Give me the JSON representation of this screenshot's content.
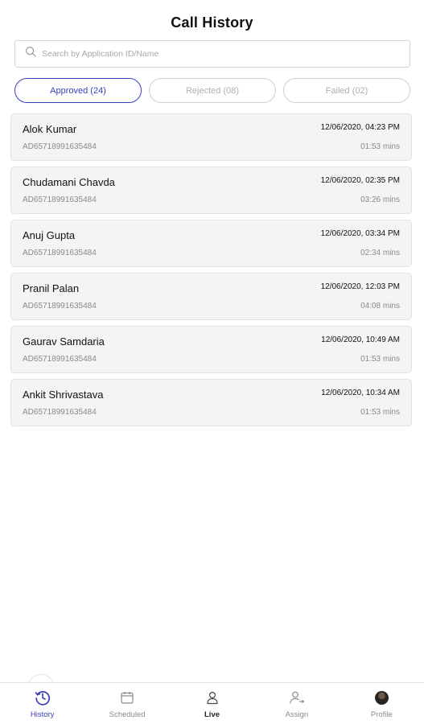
{
  "header": {
    "title": "Call History"
  },
  "search": {
    "placeholder": "Search by Application ID/Name"
  },
  "tabs": [
    {
      "label": "Approved (24)",
      "active": true
    },
    {
      "label": "Rejected (08)",
      "active": false
    },
    {
      "label": "Failed (02)",
      "active": false
    }
  ],
  "calls": [
    {
      "name": "Alok Kumar",
      "app_id": "AD65718991635484",
      "datetime": "12/06/2020, 04:23 PM",
      "duration": "01:53 mins"
    },
    {
      "name": "Chudamani Chavda",
      "app_id": "AD65718991635484",
      "datetime": "12/06/2020, 02:35 PM",
      "duration": "03:26 mins"
    },
    {
      "name": "Anuj Gupta",
      "app_id": "AD65718991635484",
      "datetime": "12/06/2020, 03:34 PM",
      "duration": "02:34 mins"
    },
    {
      "name": "Pranil Palan",
      "app_id": "AD65718991635484",
      "datetime": "12/06/2020, 12:03 PM",
      "duration": "04:08 mins"
    },
    {
      "name": "Gaurav Samdaria",
      "app_id": "AD65718991635484",
      "datetime": "12/06/2020, 10:49 AM",
      "duration": "01:53 mins"
    },
    {
      "name": "Ankit Shrivastava",
      "app_id": "AD65718991635484",
      "datetime": "12/06/2020, 10:34 AM",
      "duration": "01:53 mins"
    }
  ],
  "bottom_nav": [
    {
      "label": "History",
      "icon": "history-icon",
      "active": true
    },
    {
      "label": "Scheduled",
      "icon": "calendar-icon",
      "active": false
    },
    {
      "label": "Live",
      "icon": "person-icon",
      "active": false
    },
    {
      "label": "Assign",
      "icon": "assign-user-icon",
      "active": false
    },
    {
      "label": "Profile",
      "icon": "avatar",
      "active": false
    }
  ],
  "colors": {
    "accent": "#3a3fb8",
    "card_bg": "#f4f4f4",
    "muted": "#8a8a8a"
  }
}
